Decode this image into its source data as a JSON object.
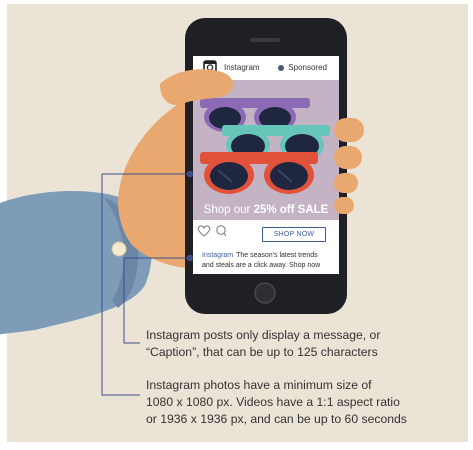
{
  "post": {
    "brand": "Instagram",
    "sponsored": "Sponsored",
    "sale_prefix": "Shop our",
    "sale_highlight": "25% off SALE",
    "cta": "SHOP NOW",
    "caption_handle": "Instagram",
    "caption_text": "The season's latest trends and steals are a click away. Shop now"
  },
  "annotations": {
    "caption_note_line1": "Instagram posts only display a message, or",
    "caption_note_line2": "“Caption”, that can be up to 125 characters",
    "photo_note_line1": "Instagram photos have a minimum size of",
    "photo_note_line2": "1080 x 1080 px. Videos have a 1:1 aspect ratio",
    "photo_note_line3": "or 1936 x 1936 px, and can be up to 60 seconds"
  },
  "colors": {
    "background": "#ece3d7",
    "skin": "#e9a86f",
    "sleeve": "#7e9bb8",
    "phone": "#1f2024",
    "photo_bg": "#c4b3c4",
    "glasses_purple": "#8c6ab6",
    "glasses_teal": "#67c6ba",
    "glasses_red": "#e2523b",
    "lens": "#1f2740",
    "accent_blue": "#3b5a9a",
    "callout_line": "#3b4f8a"
  },
  "icons": [
    "instagram-icon",
    "heart-icon",
    "comment-icon",
    "sponsored-dot-icon",
    "home-button-icon",
    "callout-dot-icon"
  ]
}
